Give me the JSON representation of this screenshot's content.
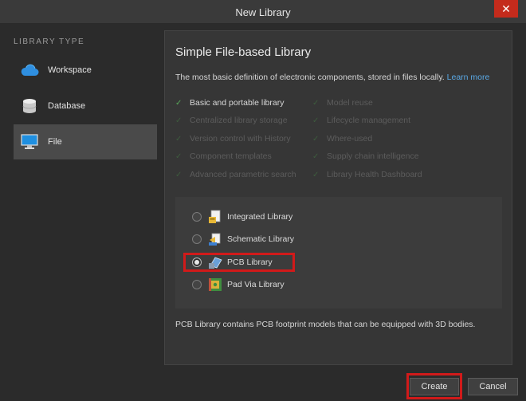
{
  "window": {
    "title": "New Library",
    "close_glyph": "✕"
  },
  "sidebar": {
    "heading": "LIBRARY TYPE",
    "items": [
      {
        "label": "Workspace",
        "icon": "cloud-icon",
        "selected": false
      },
      {
        "label": "Database",
        "icon": "database-icon",
        "selected": false
      },
      {
        "label": "File",
        "icon": "monitor-icon",
        "selected": true
      }
    ]
  },
  "main": {
    "heading": "Simple File-based Library",
    "description": "The most basic definition of electronic components, stored in files locally.",
    "learn_more": "Learn more",
    "features_left": [
      {
        "label": "Basic and portable library",
        "enabled": true
      },
      {
        "label": "Centralized library storage",
        "enabled": false
      },
      {
        "label": "Version control with History",
        "enabled": false
      },
      {
        "label": "Component templates",
        "enabled": false
      },
      {
        "label": "Advanced parametric search",
        "enabled": false
      }
    ],
    "features_right": [
      {
        "label": "Model reuse",
        "enabled": false
      },
      {
        "label": "Lifecycle management",
        "enabled": false
      },
      {
        "label": "Where-used",
        "enabled": false
      },
      {
        "label": "Supply chain intelligence",
        "enabled": false
      },
      {
        "label": "Library Health Dashboard",
        "enabled": false
      }
    ],
    "check_glyph": "✓",
    "library_types": [
      {
        "label": "Integrated Library",
        "icon": "integrated-library-icon",
        "checked": false
      },
      {
        "label": "Schematic Library",
        "icon": "schematic-library-icon",
        "checked": false
      },
      {
        "label": "PCB Library",
        "icon": "pcb-library-icon",
        "checked": true
      },
      {
        "label": "Pad Via Library",
        "icon": "pad-via-library-icon",
        "checked": false
      }
    ],
    "footnote": "PCB Library contains PCB footprint models that can be equipped with 3D bodies."
  },
  "footer": {
    "create_label": "Create",
    "cancel_label": "Cancel"
  },
  "colors": {
    "highlight": "#d11a1a",
    "link": "#5aa9e6",
    "check_on": "#58a85a"
  }
}
